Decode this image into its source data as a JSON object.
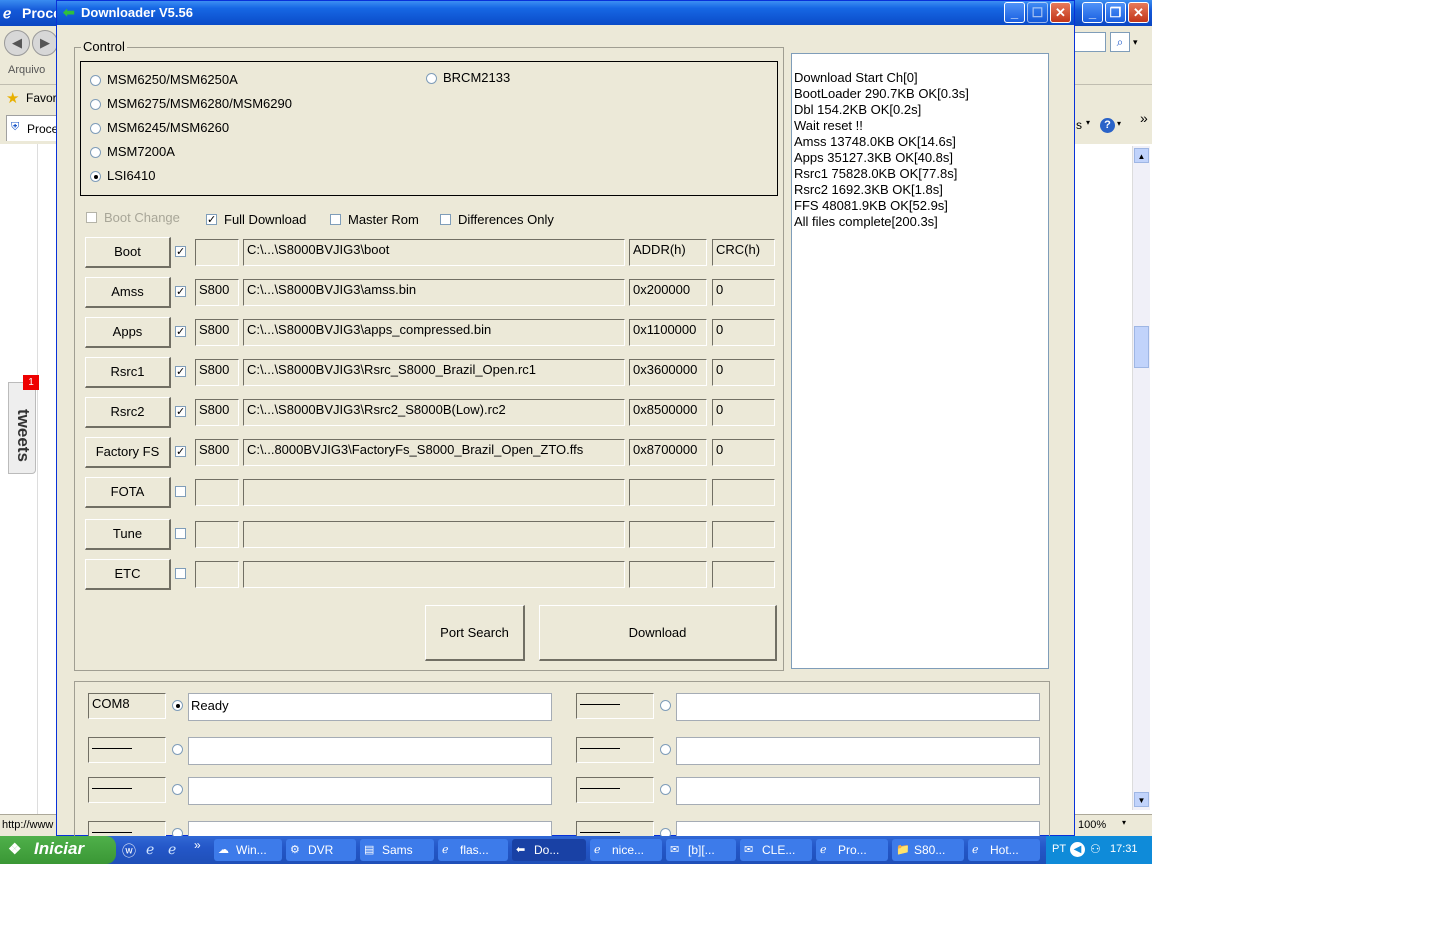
{
  "ie": {
    "title": "Proce",
    "menu_first": "Arquivo",
    "favorites": "Favori",
    "tab": "Proce",
    "toolbar_right": "s",
    "status_url": "http://www",
    "zoom": "100%",
    "tweets_label": "tweets",
    "tweets_count": "1"
  },
  "downloader": {
    "title": "Downloader V5.56",
    "control_label": "Control",
    "chipsets": [
      {
        "label": "MSM6250/MSM6250A",
        "selected": false
      },
      {
        "label": "MSM6275/MSM6280/MSM6290",
        "selected": false
      },
      {
        "label": "MSM6245/MSM6260",
        "selected": false
      },
      {
        "label": "MSM7200A",
        "selected": false
      },
      {
        "label": "LSI6410",
        "selected": true
      },
      {
        "label": "BRCM2133",
        "selected": false
      }
    ],
    "options": {
      "boot_change": "Boot Change",
      "full_download": "Full Download",
      "master_rom": "Master Rom",
      "differences_only": "Differences Only"
    },
    "header": {
      "addr": "ADDR(h)",
      "crc": "CRC(h)"
    },
    "rows": [
      {
        "label": "Boot",
        "checked": true,
        "prefix": "",
        "path": "C:\\...\\S8000BVJIG3\\boot",
        "addr": "ADDR(h)",
        "crc": "CRC(h)"
      },
      {
        "label": "Amss",
        "checked": true,
        "prefix": "S800",
        "path": "C:\\...\\S8000BVJIG3\\amss.bin",
        "addr": "0x200000",
        "crc": "0"
      },
      {
        "label": "Apps",
        "checked": true,
        "prefix": "S800",
        "path": "C:\\...\\S8000BVJIG3\\apps_compressed.bin",
        "addr": "0x1100000",
        "crc": "0"
      },
      {
        "label": "Rsrc1",
        "checked": true,
        "prefix": "S800",
        "path": "C:\\...\\S8000BVJIG3\\Rsrc_S8000_Brazil_Open.rc1",
        "addr": "0x3600000",
        "crc": "0"
      },
      {
        "label": "Rsrc2",
        "checked": true,
        "prefix": "S800",
        "path": "C:\\...\\S8000BVJIG3\\Rsrc2_S8000B(Low).rc2",
        "addr": "0x8500000",
        "crc": "0"
      },
      {
        "label": "Factory FS",
        "checked": true,
        "prefix": "S800",
        "path": "C:\\...8000BVJIG3\\FactoryFs_S8000_Brazil_Open_ZTO.ffs",
        "addr": "0x8700000",
        "crc": "0"
      },
      {
        "label": "FOTA",
        "checked": false,
        "prefix": "",
        "path": "",
        "addr": "",
        "crc": ""
      },
      {
        "label": "Tune",
        "checked": false,
        "prefix": "",
        "path": "",
        "addr": "",
        "crc": ""
      },
      {
        "label": "ETC",
        "checked": false,
        "prefix": "",
        "path": "",
        "addr": "",
        "crc": ""
      }
    ],
    "port_search": "Port Search",
    "download": "Download",
    "log": [
      "Download Start Ch[0]",
      "BootLoader 290.7KB OK[0.3s]",
      "Dbl 154.2KB OK[0.2s]",
      "Wait reset !!",
      "Amss 13748.0KB OK[14.6s]",
      "Apps 35127.3KB OK[40.8s]",
      "Rsrc1 75828.0KB OK[77.8s]",
      "Rsrc2 1692.3KB OK[1.8s]",
      "FFS 48081.9KB OK[52.9s]",
      "All files complete[200.3s]"
    ],
    "ports": [
      {
        "port": "COM8",
        "status": "Ready",
        "selected": true
      },
      {
        "port": "",
        "status": "",
        "selected": false
      },
      {
        "port": "",
        "status": "",
        "selected": false
      },
      {
        "port": "",
        "status": "",
        "selected": false
      },
      {
        "port": "",
        "status": "",
        "selected": false
      },
      {
        "port": "",
        "status": "",
        "selected": false
      },
      {
        "port": "",
        "status": "",
        "selected": false
      },
      {
        "port": "",
        "status": "",
        "selected": false
      }
    ]
  },
  "taskbar": {
    "start": "Iniciar",
    "buttons": [
      {
        "label": "Win...",
        "active": false
      },
      {
        "label": "DVR",
        "active": false
      },
      {
        "label": "Sams",
        "active": false
      },
      {
        "label": "flas...",
        "active": false
      },
      {
        "label": "Do...",
        "active": true
      },
      {
        "label": "nice...",
        "active": false
      },
      {
        "label": "[b][...",
        "active": false
      },
      {
        "label": "CLE...",
        "active": false
      },
      {
        "label": "Pro...",
        "active": false
      },
      {
        "label": "S80...",
        "active": false
      },
      {
        "label": "Hot...",
        "active": false
      }
    ],
    "lang": "PT",
    "clock": "17:31"
  }
}
